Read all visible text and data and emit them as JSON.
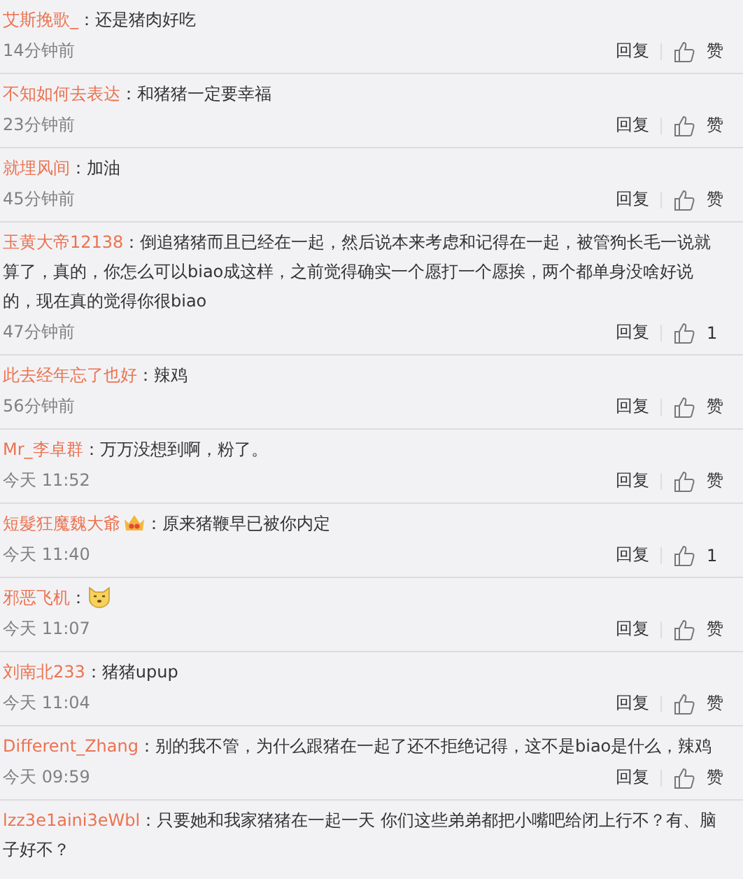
{
  "comments": [
    {
      "user": "艾斯挽歌_",
      "colon": "：",
      "text": "还是猪肉好吃",
      "time": "14分钟前",
      "reply": "回复",
      "like": "赞"
    },
    {
      "user": "不知如何去表达",
      "colon": "：",
      "text": "和猪猪一定要幸福",
      "time": "23分钟前",
      "reply": "回复",
      "like": "赞"
    },
    {
      "user": "就埋风间",
      "colon": "：",
      "text": "加油",
      "time": "45分钟前",
      "reply": "回复",
      "like": "赞"
    },
    {
      "user": "玉黄大帝12138",
      "colon": "：",
      "text": "倒追猪猪而且已经在一起，然后说本来考虑和记得在一起，被管狗长毛一说就算了，真的，你怎么可以biao成这样，之前觉得确实一个愿打一个愿挨，两个都单身没啥好说的，现在真的觉得你很biao",
      "time": "47分钟前",
      "reply": "回复",
      "like": "1"
    },
    {
      "user": "此去经年忘了也好",
      "colon": "：",
      "text": "辣鸡",
      "time": "56分钟前",
      "reply": "回复",
      "like": "赞"
    },
    {
      "user": "Mr_李卓群",
      "colon": "：",
      "text": "万万没想到啊，粉了。",
      "time": "今天 11:52",
      "reply": "回复",
      "like": "赞"
    },
    {
      "user": "短髮狂魔魏大爺",
      "badge": true,
      "colon": "：",
      "text": "原来猪鞭早已被你内定",
      "time": "今天 11:40",
      "reply": "回复",
      "like": "1"
    },
    {
      "user": "邪恶飞机",
      "colon": "：",
      "emoji": true,
      "time": "今天 11:07",
      "reply": "回复",
      "like": "赞"
    },
    {
      "user": "刘南北233",
      "colon": "：",
      "text": "猪猪upup",
      "time": "今天 11:04",
      "reply": "回复",
      "like": "赞"
    },
    {
      "user": "Different_Zhang",
      "colon": "：",
      "text": "别的我不管，为什么跟猪在一起了还不拒绝记得，这不是biao是什么，辣鸡",
      "time": "今天 09:59",
      "reply": "回复",
      "like": "赞"
    },
    {
      "user": "lzz3e1aini3eWbl",
      "colon": "：",
      "text": "只要她和我家猪猪在一起一天 你们这些弟弟都把小嘴吧给闭上行不？有、脑子好不？"
    }
  ]
}
